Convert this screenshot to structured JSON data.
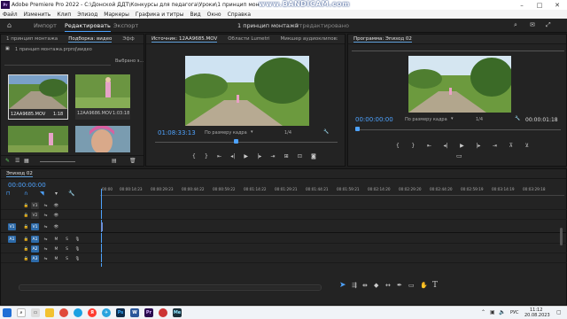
{
  "window": {
    "app_badge": "Pr",
    "title": "Adobe Premiere Pro 2022 - C:\\Донской ДДТ\\Конкурсы для педагога\\Уроки\\1 принцип монтажа\\1 принцип монтажа.prproj",
    "watermark": "www.BANDICAM.com"
  },
  "menu": [
    "Файл",
    "Изменить",
    "Клип",
    "Эпизод",
    "Маркеры",
    "Графика и титры",
    "Вид",
    "Окно",
    "Справка"
  ],
  "workspace": {
    "home_icon": "home-icon",
    "tabs": [
      "Импорт",
      "Редактировать",
      "Экспорт"
    ],
    "active_tab": "Редактировать",
    "project_name": "1 принцип монтажа",
    "status": "- Отредактировано"
  },
  "project_panel": {
    "tabs": [
      "1 принцип монтажа",
      "Подборка: видео",
      "Эфф"
    ],
    "path": "1 принцип монтажа.prproj\\видео",
    "selected_label": "Выбрано э...",
    "clips": [
      {
        "name": "12AA9685.MOV",
        "duration": "1:18"
      },
      {
        "name": "12AA9686.MOV",
        "duration": "1:03:18"
      },
      {
        "name": "",
        "duration": ""
      },
      {
        "name": "",
        "duration": ""
      }
    ]
  },
  "source_monitor": {
    "tabs": [
      "Источник: 12AA9685.MOV",
      "Области Lumetri",
      "Микшер аудиоклипов:"
    ],
    "timecode": "01:08:33:13",
    "fit": "По размеру кадра",
    "resolution": "1/4"
  },
  "program_monitor": {
    "title": "Программа: Эпизод 02",
    "timecode_in": "00:00:00:00",
    "fit": "По размеру кадра",
    "resolution": "1/4",
    "duration": "00:00:01:18"
  },
  "timeline": {
    "tab": "Эпизод 02",
    "timecode": "00:00:00:00",
    "ruler": [
      "00:00",
      "00:00:14:23",
      "00:00:29:23",
      "00:00:44:22",
      "00:00:59:22",
      "00:01:14:22",
      "00:01:29:21",
      "00:01:44:21",
      "00:01:59:21",
      "00:02:14:20",
      "00:02:29:20",
      "00:02:44:20",
      "00:02:59:19",
      "00:03:14:19",
      "00:03:29:18"
    ],
    "video_tracks": [
      "V3",
      "V2",
      "V1"
    ],
    "audio_tracks": [
      "A1",
      "A2",
      "A3"
    ],
    "source_patch_video": "V1",
    "source_patch_audio": "A1",
    "mute": "M",
    "solo": "S"
  },
  "taskbar": {
    "language": "РУС",
    "time": "11:12",
    "date": "20.08.2023"
  },
  "colors": {
    "accent_blue": "#4ea3ff",
    "panel": "#232323",
    "track_blue": "#2d6aa8"
  }
}
